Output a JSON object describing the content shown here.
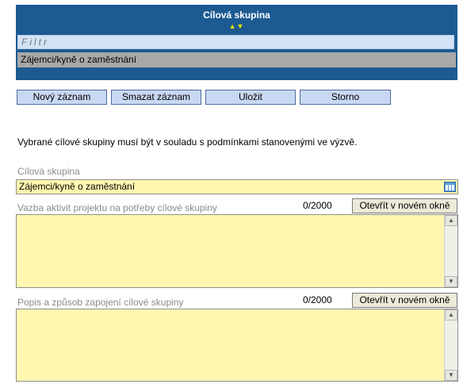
{
  "grid": {
    "title": "Cílová skupina",
    "sort_icons": "▲▼",
    "filter_placeholder": "Filtr",
    "rows": [
      "Zájemci/kyně o zaměstnání"
    ]
  },
  "toolbar": {
    "new_label": "Nový záznam",
    "delete_label": "Smazat záznam",
    "save_label": "Uložit",
    "cancel_label": "Storno"
  },
  "info_text": "Vybrané cílové skupiny musí být v souladu s podmínkami stanovenými ve výzvě.",
  "target_group": {
    "label": "Cílová skupina",
    "value": "Zájemci/kyně o zaměstnání"
  },
  "needs_link": {
    "label": "Vazba aktivit projektu na potřeby cílové skupiny",
    "count": "0/2000",
    "open_label": "Otevřít v novém okně",
    "value": ""
  },
  "involvement": {
    "label": "Popis a způsob zapojení cílové skupiny",
    "count": "0/2000",
    "open_label": "Otevřít v novém okně",
    "value": ""
  },
  "colors": {
    "header_blue": "#1d5a92",
    "field_yellow": "#fff7b0",
    "button_blue": "#c9d8f2",
    "row_gray": "#a8a8a8"
  }
}
